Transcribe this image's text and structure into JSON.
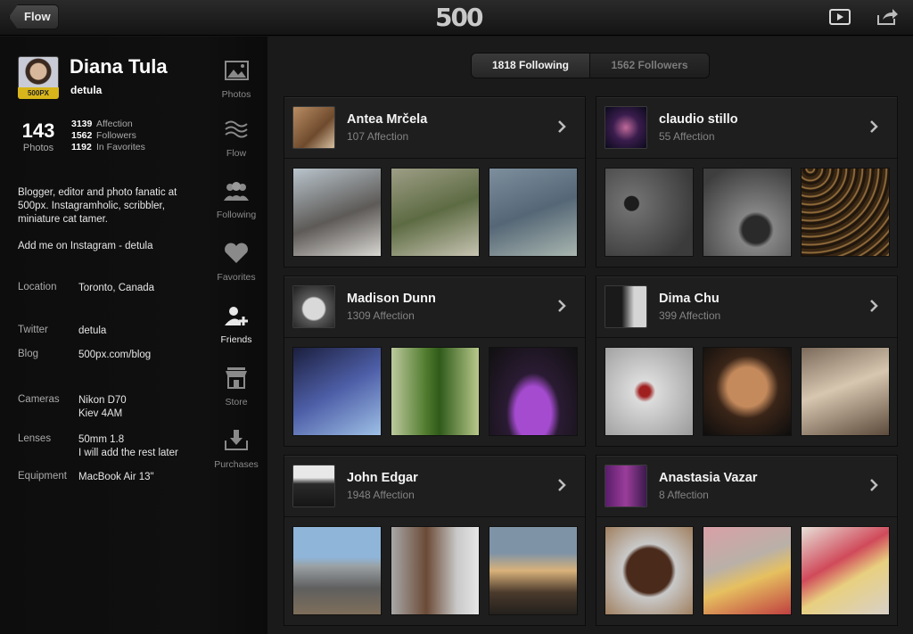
{
  "topbar": {
    "back_label": "Flow",
    "logo_text": "500",
    "play_icon": "play-icon",
    "share_icon": "share-icon"
  },
  "profile": {
    "name": "Diana Tula",
    "handle": "detula",
    "badge": "500PX",
    "photos_count": "143",
    "photos_label": "Photos",
    "stats": [
      {
        "value": "3139",
        "label": "Affection"
      },
      {
        "value": "1562",
        "label": "Followers"
      },
      {
        "value": "1192",
        "label": "In Favorites"
      }
    ],
    "bio": "Blogger, editor and photo fanatic at 500px. Instagramholic, scribbler, miniature cat tamer.",
    "instagram": "Add me on Instagram - detula",
    "info": {
      "location_label": "Location",
      "location": "Toronto, Canada",
      "twitter_label": "Twitter",
      "twitter": "detula",
      "blog_label": "Blog",
      "blog": "500px.com/blog",
      "cameras_label": "Cameras",
      "cameras_1": "Nikon D70",
      "cameras_2": "Kiev 4AM",
      "lenses_label": "Lenses",
      "lenses_1": "50mm 1.8",
      "lenses_2": "I will add the rest later",
      "equipment_label": "Equipment",
      "equipment": "MacBook Air 13\""
    }
  },
  "nav": [
    {
      "label": "Photos",
      "icon": "photos-icon"
    },
    {
      "label": "Flow",
      "icon": "flow-icon"
    },
    {
      "label": "Following",
      "icon": "following-icon"
    },
    {
      "label": "Favorites",
      "icon": "heart-icon"
    },
    {
      "label": "Friends",
      "icon": "add-friend-icon",
      "active": true
    },
    {
      "label": "Store",
      "icon": "store-icon"
    },
    {
      "label": "Purchases",
      "icon": "download-icon"
    }
  ],
  "tabs": {
    "following": "1818 Following",
    "followers": "1562 Followers"
  },
  "people": [
    {
      "name": "Antea Mrčela",
      "affection": "107 Affection"
    },
    {
      "name": "claudio stillo",
      "affection": "55 Affection"
    },
    {
      "name": "Madison Dunn",
      "affection": "1309 Affection"
    },
    {
      "name": "Dima Chu",
      "affection": "399 Affection"
    },
    {
      "name": "John Edgar",
      "affection": "1948 Affection"
    },
    {
      "name": "Anastasia Vazar",
      "affection": "8 Affection"
    }
  ],
  "colors": {
    "background": "#151515",
    "card": "#1e1e1e",
    "badge": "#d8b51a"
  }
}
